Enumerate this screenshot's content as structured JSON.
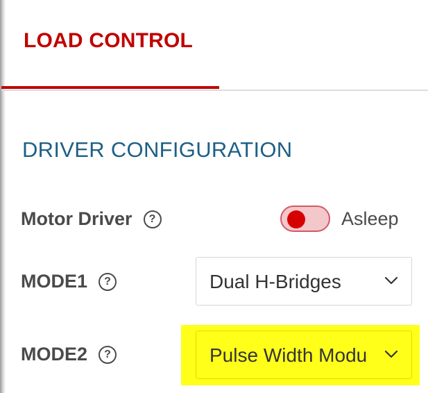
{
  "tab": {
    "label": "LOAD CONTROL"
  },
  "section": {
    "title": "DRIVER CONFIGURATION"
  },
  "help_icon_glyph": "?",
  "motor_driver": {
    "label": "Motor Driver",
    "toggle_state": "Asleep"
  },
  "mode1": {
    "label": "MODE1",
    "selected": "Dual H-Bridges"
  },
  "mode2": {
    "label": "MODE2",
    "selected": "Pulse Width Modu"
  },
  "colors": {
    "accent_red": "#c00000",
    "section_blue": "#1d5f85",
    "highlight_yellow": "#ffff1a"
  },
  "icons": [
    "help-circle-icon",
    "chevron-down-icon"
  ]
}
